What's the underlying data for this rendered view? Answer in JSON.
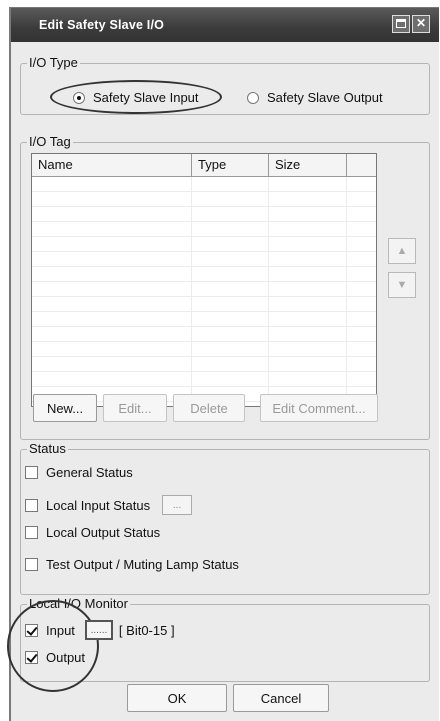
{
  "window": {
    "title": "Edit Safety Slave I/O"
  },
  "io_type": {
    "group_label": "I/O Type",
    "options": [
      "Safety Slave Input",
      "Safety Slave Output"
    ],
    "selected": "Safety Slave Input"
  },
  "io_tag": {
    "group_label": "I/O Tag",
    "columns": [
      "Name",
      "Type",
      "Size"
    ],
    "rows": [],
    "buttons": {
      "new": "New...",
      "edit": "Edit...",
      "delete": "Delete",
      "edit_comment": "Edit Comment..."
    }
  },
  "status": {
    "group_label": "Status",
    "items": [
      {
        "label": "General Status",
        "checked": false
      },
      {
        "label": "Local Input Status",
        "checked": false
      },
      {
        "label": "Local Output Status",
        "checked": false
      },
      {
        "label": "Test Output / Muting Lamp Status",
        "checked": false
      }
    ],
    "ellipsis": "..."
  },
  "local_io_monitor": {
    "group_label": "Local I/O Monitor",
    "input_label": "Input",
    "input_checked": true,
    "bit_range": "[ Bit0-15 ]",
    "ellipsis": "......",
    "output_label": "Output",
    "output_checked": true
  },
  "footer": {
    "ok": "OK",
    "cancel": "Cancel"
  }
}
